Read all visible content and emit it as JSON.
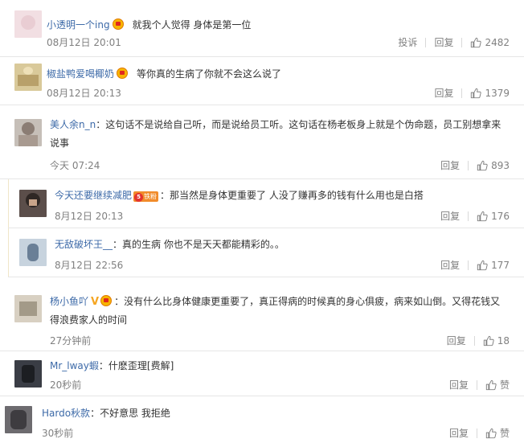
{
  "comments": [
    {
      "username": "小透明一个ing",
      "badge": "crown",
      "text": "就我个人觉得 身体是第一位",
      "time": "08月12日 20:01",
      "report_label": "投诉",
      "reply_label": "回复",
      "like_count": "2482",
      "avatar_colors": [
        "#f2dfe3",
        "#e9cdd3"
      ]
    },
    {
      "username": "椒盐鸭爱喝椰奶",
      "badge": "crown",
      "text": "等你真的生病了你就不会这么说了",
      "time": "08月12日 20:13",
      "reply_label": "回复",
      "like_count": "1379",
      "avatar_colors": [
        "#d9c99a",
        "#b8a06a"
      ]
    },
    {
      "username": "美人余n_n",
      "colon": "：",
      "text": "这句话不是说给自己听，而是说给员工听。这句话在杨老板身上就是个伪命题，员工别想拿来说事",
      "time": "今天 07:24",
      "reply_label": "回复",
      "like_count": "893",
      "avatar_colors": [
        "#c6bfb8",
        "#8b7d74"
      ]
    },
    {
      "username": "今天还要继续减肥",
      "badge": "fan",
      "fan_level": "5",
      "fan_text": "铁粉",
      "colon": "：",
      "text": "那当然是身体更重要了  人没了赚再多的钱有什么用也是白搭",
      "time": "8月12日 20:13",
      "reply_label": "回复",
      "like_count": "176",
      "avatar_colors": [
        "#5b4e4a",
        "#2f2724"
      ]
    },
    {
      "username": "无敌破坏王__",
      "colon": "：",
      "text": "真的生病 你也不是天天都能精彩的。。",
      "time": "8月12日 22:56",
      "reply_label": "回复",
      "like_count": "177",
      "avatar_colors": [
        "#c7d3de",
        "#6a7f96"
      ]
    },
    {
      "username": "杨小鱼吖",
      "badge": "v-crown",
      "colon": "：",
      "text": "没有什么比身体健康更重要了，真正得病的时候真的身心俱疲，病来如山倒。又得花钱又得浪费家人的时间",
      "time": "27分钟前",
      "reply_label": "回复",
      "like_count": "18",
      "avatar_colors": [
        "#d8d0c2",
        "#a39a88"
      ]
    },
    {
      "username": "Mr_lway蝦",
      "colon": "：",
      "text": "什麽歪理[费解]",
      "time": "20秒前",
      "reply_label": "回复",
      "like_label": "赞",
      "avatar_colors": [
        "#3a3d45",
        "#1c1e22"
      ]
    },
    {
      "username": "Hardo秋款",
      "colon": "：",
      "text": "不好意思 我拒绝",
      "time": "30秒前",
      "reply_label": "回复",
      "like_label": "赞",
      "avatar_colors": [
        "#6d6b6f",
        "#3e3c40"
      ]
    }
  ],
  "icons": {
    "thumb": "thumbs-up-icon",
    "crown": "crown-badge-icon",
    "v": "verified-v-icon",
    "fan": "fan-level-badge-icon"
  },
  "colors": {
    "username": "#3d6aa8",
    "meta": "#808080",
    "crown": "#f7b500",
    "fan_badge": "#f18c2b"
  }
}
